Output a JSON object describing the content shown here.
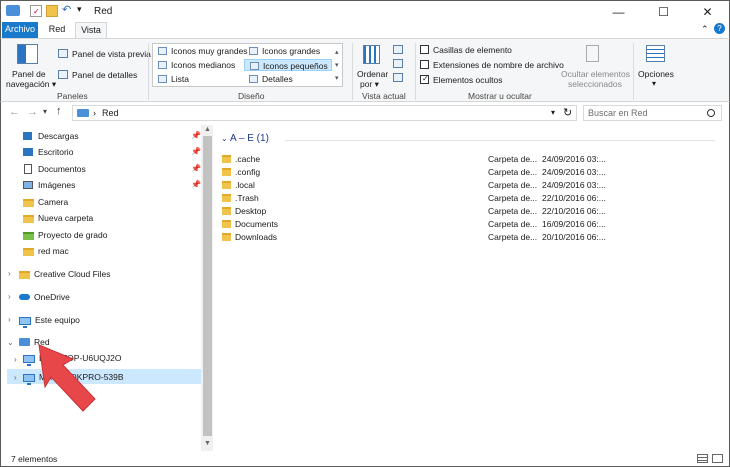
{
  "window": {
    "title": "Red",
    "minimize": "—",
    "maximize": "☐",
    "close": "✕"
  },
  "tabs": {
    "archivo": "Archivo",
    "red": "Red",
    "vista": "Vista"
  },
  "ribbon": {
    "paneles": {
      "nav_pane_line1": "Panel de",
      "nav_pane_line2": "navegación ▾",
      "preview": "Panel de vista previa",
      "details": "Panel de detalles",
      "label": "Paneles"
    },
    "diseno": {
      "items": [
        "Iconos muy grandes",
        "Iconos grandes",
        "Iconos medianos",
        "Iconos pequeños",
        "Lista",
        "Detalles"
      ],
      "label": "Diseño"
    },
    "vista_actual": {
      "sort_line1": "Ordenar",
      "sort_line2": "por ▾",
      "label": "Vista actual"
    },
    "mostrar": {
      "casillas": "Casillas de elemento",
      "extensiones": "Extensiones de nombre de archivo",
      "ocultos": "Elementos ocultos",
      "hide_line1": "Ocultar elementos",
      "hide_line2": "seleccionados",
      "label": "Mostrar u ocultar"
    },
    "opciones": {
      "label": "Opciones"
    }
  },
  "address": {
    "path": "Red",
    "search_placeholder": "Buscar en Red"
  },
  "nav": {
    "quick_access": [
      {
        "label": "Descargas",
        "pinned": true
      },
      {
        "label": "Escritorio",
        "pinned": true
      },
      {
        "label": "Documentos",
        "pinned": true
      },
      {
        "label": "Imágenes",
        "pinned": true
      },
      {
        "label": "Camera",
        "pinned": false
      },
      {
        "label": "Nueva carpeta",
        "pinned": false
      },
      {
        "label": "Proyecto de grado",
        "pinned": false
      },
      {
        "label": "red mac",
        "pinned": false
      }
    ],
    "creative_cloud": "Creative Cloud Files",
    "onedrive": "OneDrive",
    "este_equipo": "Este equipo",
    "red": "Red",
    "red_children": [
      "DESKTOP-U6UQJ2O",
      "MACBOOKPRO-539B"
    ]
  },
  "main": {
    "group_header": "A – E (1)",
    "files": [
      {
        "name": ".cache",
        "type": "Carpeta de...",
        "date": "24/09/2016 03:..."
      },
      {
        "name": ".config",
        "type": "Carpeta de...",
        "date": "24/09/2016 03:..."
      },
      {
        "name": ".local",
        "type": "Carpeta de...",
        "date": "24/09/2016 03:..."
      },
      {
        "name": ".Trash",
        "type": "Carpeta de...",
        "date": "22/10/2016 06:..."
      },
      {
        "name": "Desktop",
        "type": "Carpeta de...",
        "date": "22/10/2016 06:..."
      },
      {
        "name": "Documents",
        "type": "Carpeta de...",
        "date": "16/09/2016 06:..."
      },
      {
        "name": "Downloads",
        "type": "Carpeta de...",
        "date": "20/10/2016 06:..."
      }
    ]
  },
  "status": {
    "count": "7 elementos"
  },
  "colors": {
    "accent": "#1979ca",
    "selection": "#cce8ff",
    "arrow": "#e8474a"
  }
}
